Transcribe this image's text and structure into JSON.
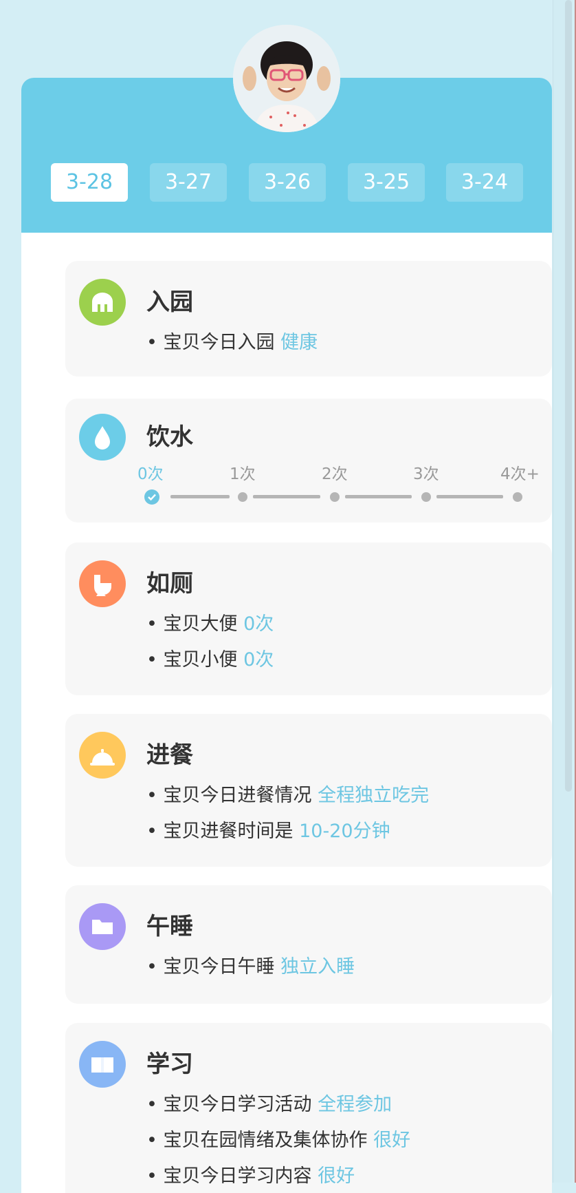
{
  "dates": [
    "3-28",
    "3-27",
    "3-26",
    "3-25",
    "3-24"
  ],
  "active_date_index": 0,
  "sections": {
    "arrival": {
      "title": "入园",
      "icon": "school-gate-icon",
      "color": "#9cd04d",
      "lines": [
        {
          "text": "• 宝贝今日入园",
          "value": "健康"
        }
      ]
    },
    "water": {
      "title": "饮水",
      "icon": "water-drop-icon",
      "color": "#6ccde8",
      "levels": [
        "0次",
        "1次",
        "2次",
        "3次",
        "4次+"
      ],
      "selected_level": 0
    },
    "toilet": {
      "title": "如厕",
      "icon": "toilet-icon",
      "color": "#ff8d5e",
      "lines": [
        {
          "text": "• 宝贝大便",
          "value": "0次"
        },
        {
          "text": "• 宝贝小便",
          "value": "0次"
        }
      ]
    },
    "meal": {
      "title": "进餐",
      "icon": "meal-bell-icon",
      "color": "#ffc85c",
      "lines": [
        {
          "text": "• 宝贝今日进餐情况",
          "value": "全程独立吃完"
        },
        {
          "text": "• 宝贝进餐时间是",
          "value": "10-20分钟"
        }
      ]
    },
    "nap": {
      "title": "午睡",
      "icon": "bed-icon",
      "color": "#a999f5",
      "lines": [
        {
          "text": "• 宝贝今日午睡",
          "value": "独立入睡"
        }
      ]
    },
    "study": {
      "title": "学习",
      "icon": "book-icon",
      "color": "#88b6f5",
      "lines": [
        {
          "text": "• 宝贝今日学习活动",
          "value": "全程参加"
        },
        {
          "text": "• 宝贝在园情绪及集体协作",
          "value": "很好"
        },
        {
          "text": "• 宝贝今日学习内容",
          "value": "很好"
        }
      ]
    }
  }
}
